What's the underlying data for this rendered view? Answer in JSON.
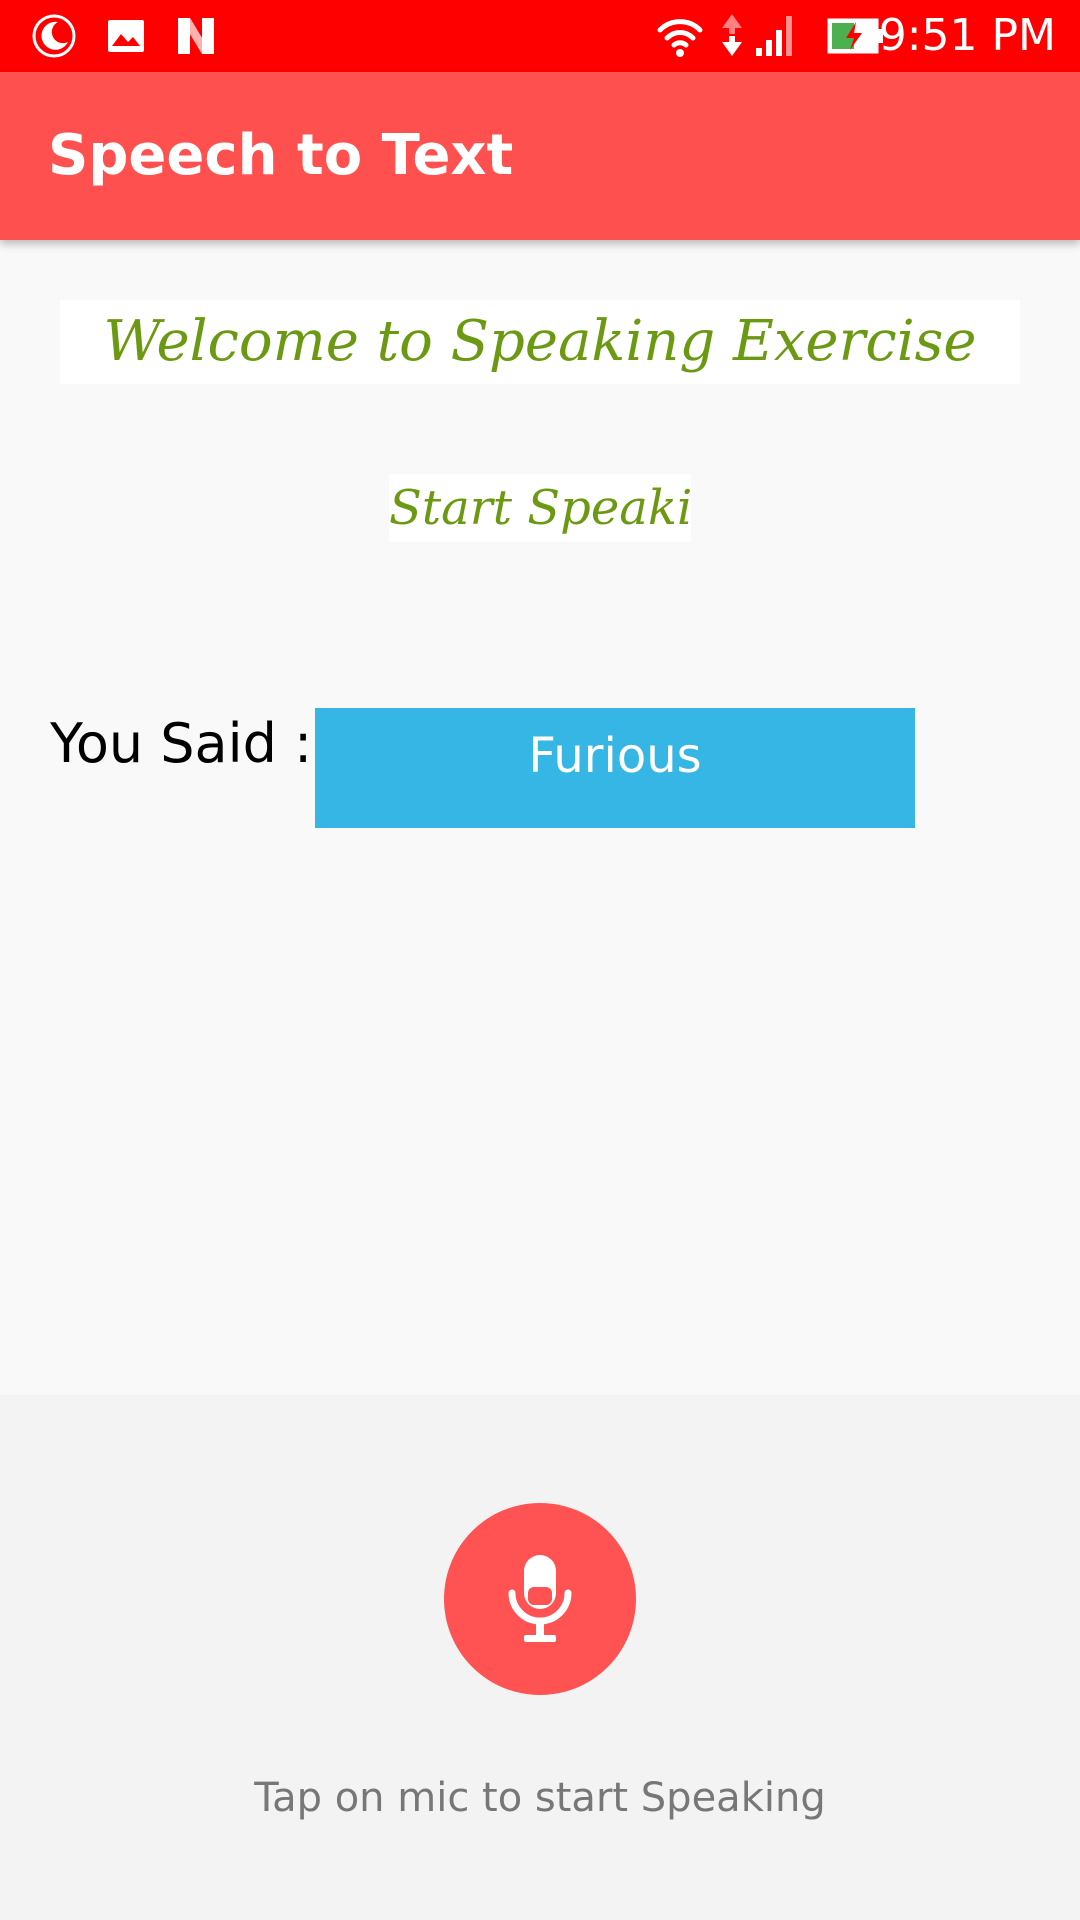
{
  "status_bar": {
    "time": "9:51 PM",
    "icons": [
      "moon-icon",
      "image-icon",
      "n-logo-icon",
      "wifi-icon",
      "data-arrows-icon",
      "signal-icon",
      "battery-charging-icon"
    ],
    "background_color": "#ff0000"
  },
  "app_bar": {
    "title": "Speech to Text",
    "background_color": "#ff5050"
  },
  "main": {
    "welcome_text": "Welcome to Speaking Exercise",
    "start_text": "Start Speaking",
    "you_said_label": "You Said :",
    "result_text": "Furious",
    "accent_green": "#6b9a12",
    "result_background": "#36b6e4"
  },
  "bottom": {
    "mic_icon": "microphone-icon",
    "hint": "Tap on mic to start Speaking",
    "mic_color": "#ff5252"
  }
}
